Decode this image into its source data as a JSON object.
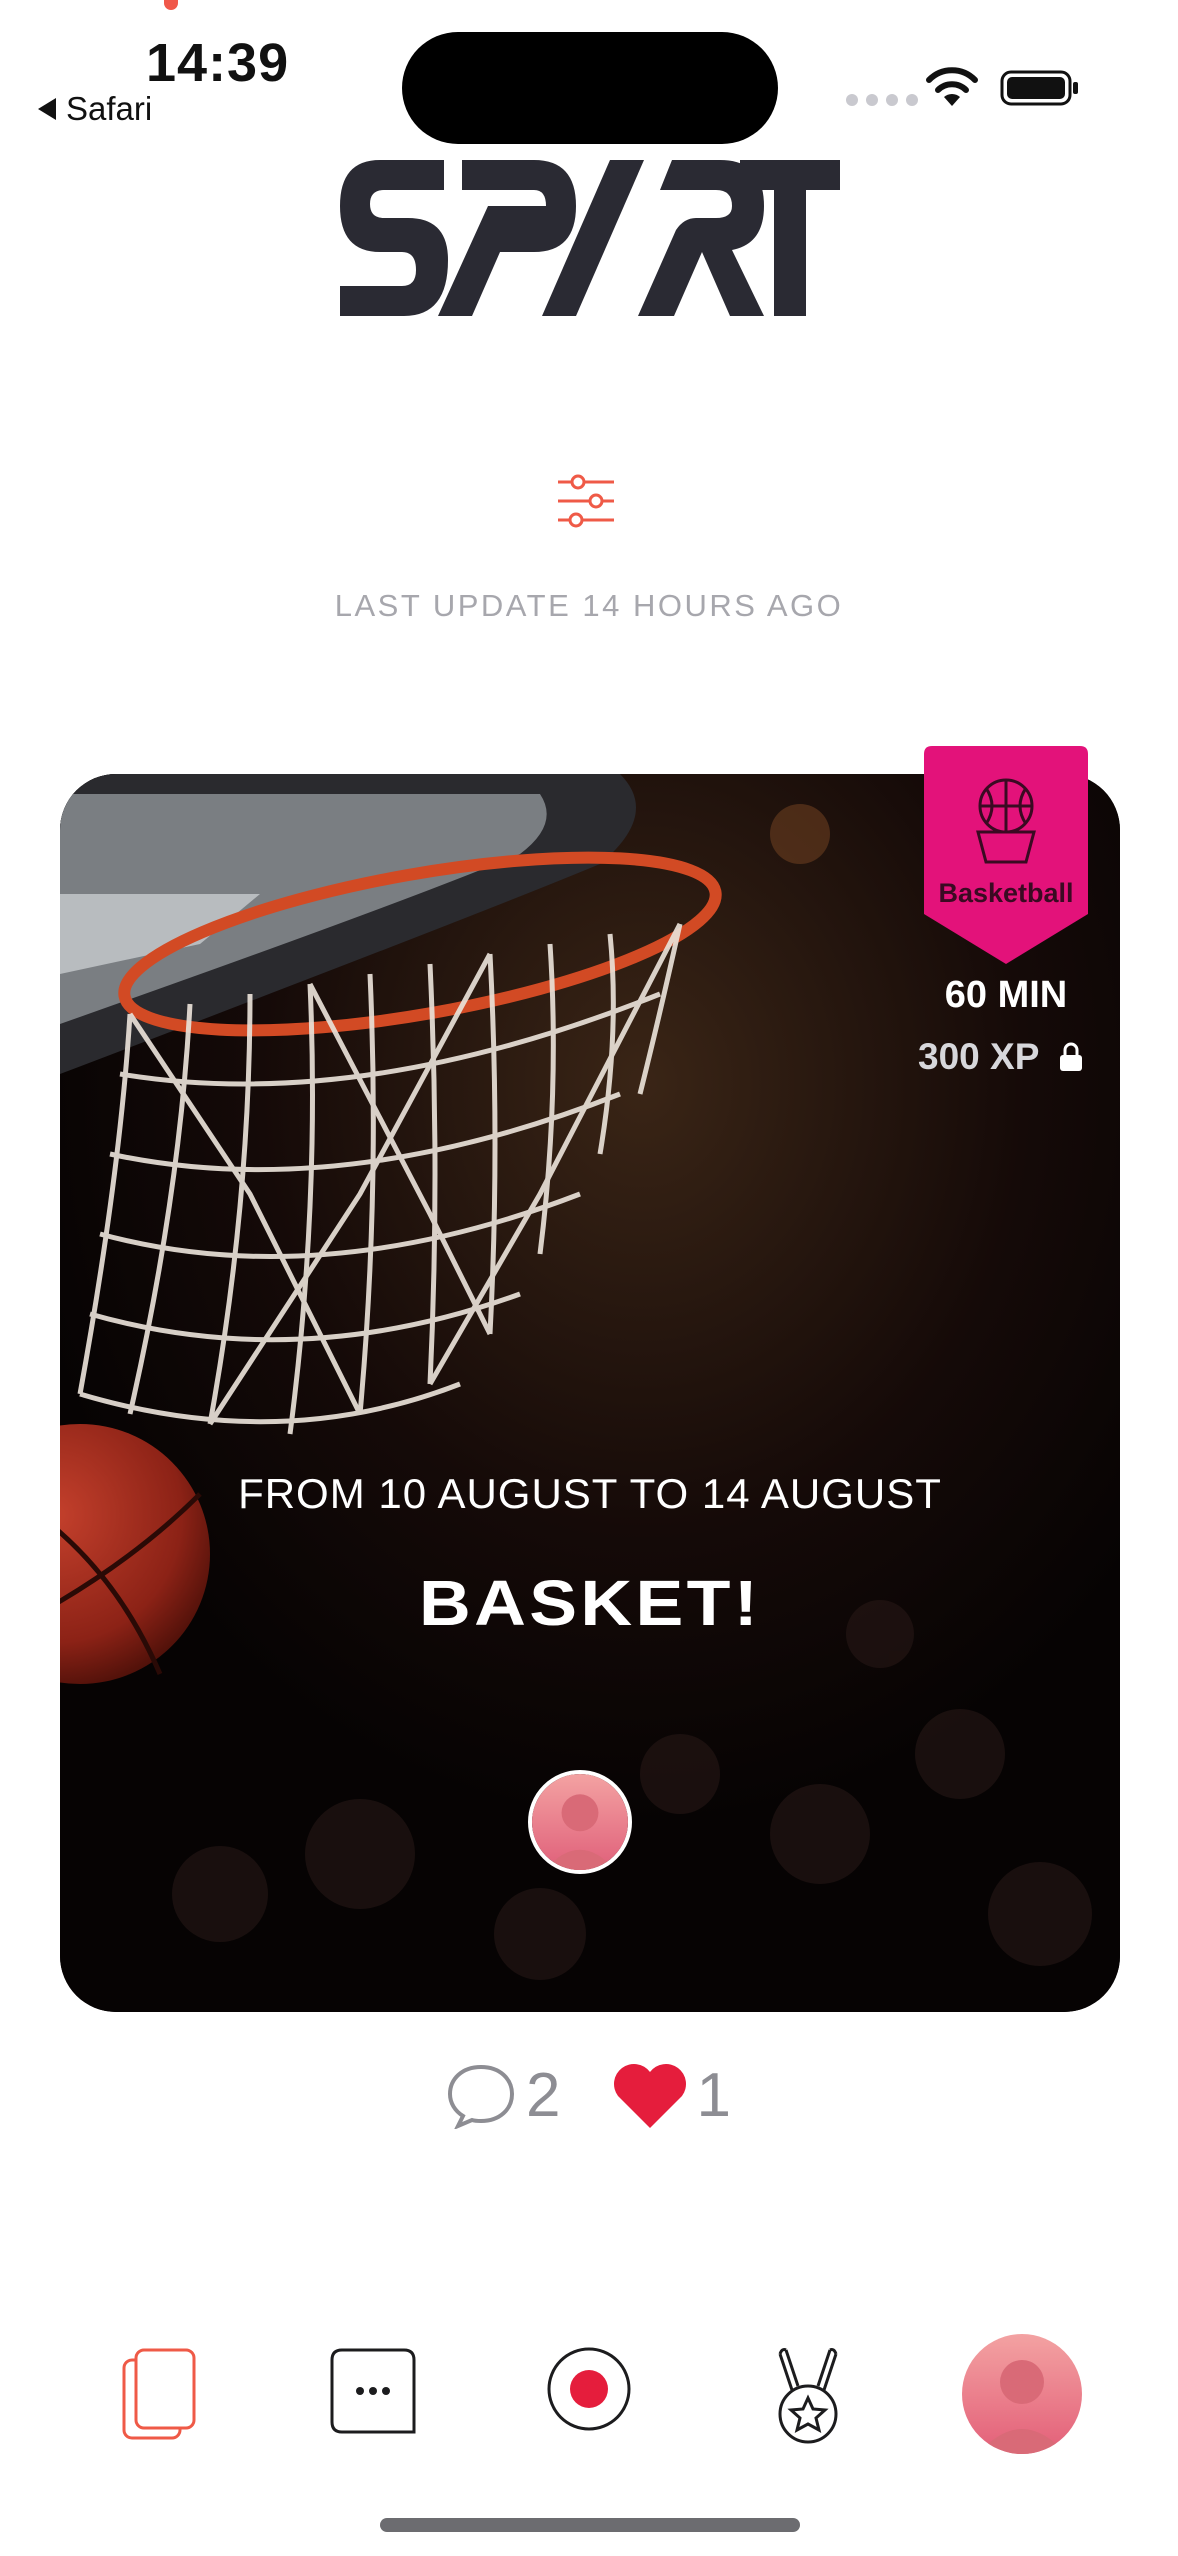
{
  "status_bar": {
    "time": "14:39",
    "back_app": "Safari"
  },
  "header": {
    "logo_text": "SPRT",
    "filter_icon": "sliders-icon",
    "last_update": "LAST UPDATE 14 HOURS AGO"
  },
  "card": {
    "category": "Basketball",
    "duration": "60 MIN",
    "xp": "300 XP",
    "dates": "FROM 10 AUGUST TO 14 AUGUST",
    "title": "BASKET!",
    "badge_color": "#e3127a"
  },
  "reactions": {
    "comments": "2",
    "likes": "1",
    "heart_color": "#e51d3c"
  },
  "tab_bar": {
    "items": [
      "feed-icon",
      "chat-icon",
      "record-icon",
      "rewards-medal-icon",
      "profile-avatar"
    ],
    "accent": "#ef5a47"
  }
}
